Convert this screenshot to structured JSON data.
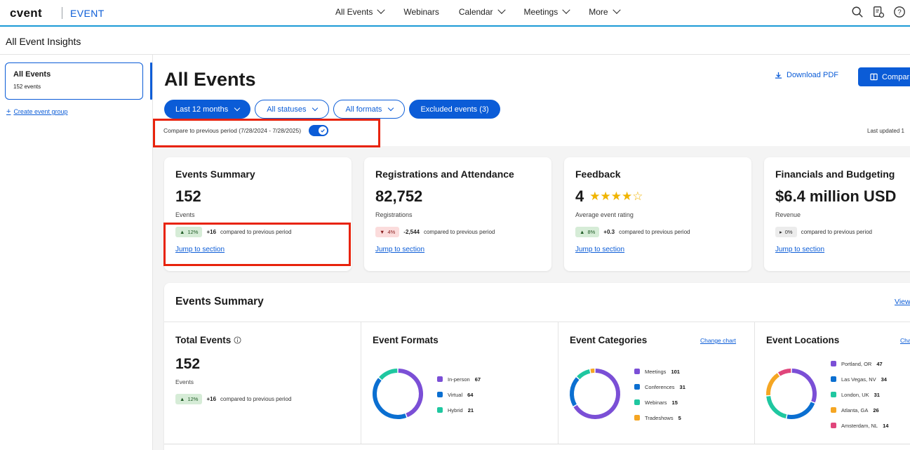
{
  "topnav": {
    "logo": "cvent",
    "product": "EVENT",
    "links": [
      {
        "label": "All Events",
        "dropdown": true
      },
      {
        "label": "Webinars",
        "dropdown": false
      },
      {
        "label": "Calendar",
        "dropdown": true
      },
      {
        "label": "Meetings",
        "dropdown": true
      },
      {
        "label": "More",
        "dropdown": true
      }
    ],
    "icons": [
      "search-icon",
      "reports-icon",
      "help-icon"
    ]
  },
  "breadcrumb": {
    "title": "All Event Insights"
  },
  "sidebar": {
    "group": {
      "name": "All Events",
      "count": "152 events"
    },
    "create_link": "Create event group"
  },
  "main": {
    "title": "All Events",
    "download_pdf": "Download PDF",
    "compare_button": "Compar",
    "filters": [
      {
        "label": "Last 12 months",
        "style": "solid",
        "dropdown": true
      },
      {
        "label": "All statuses",
        "style": "outline",
        "dropdown": true
      },
      {
        "label": "All formats",
        "style": "outline",
        "dropdown": true
      },
      {
        "label": "Excluded events (3)",
        "style": "solid",
        "dropdown": false
      }
    ],
    "compare_toggle": {
      "label": "Compare to previous period (7/28/2024 - 7/28/2025)",
      "on": true
    },
    "last_updated": "Last updated 1"
  },
  "cards": [
    {
      "title": "Events Summary",
      "value": "152",
      "label": "Events",
      "badge": "12%",
      "trend": "up",
      "change": "+16",
      "compare": "compared to previous period",
      "jump": "Jump to section"
    },
    {
      "title": "Registrations and Attendance",
      "value": "82,752",
      "label": "Registrations",
      "badge": "4%",
      "trend": "down",
      "change": "-2,544",
      "compare": "compared to previous period",
      "jump": "Jump to section"
    },
    {
      "title": "Feedback",
      "value": "4",
      "rating": 4,
      "label": "Average event rating",
      "badge": "8%",
      "trend": "up",
      "change": "+0.3",
      "compare": "compared to previous period",
      "jump": "Jump to section"
    },
    {
      "title": "Financials and Budgeting",
      "value": "$6.4 million USD",
      "label": "Revenue",
      "badge": "0%",
      "trend": "flat",
      "change": "",
      "compare": "compared to previous period",
      "jump": "Jump to section"
    }
  ],
  "section": {
    "title": "Events Summary",
    "view_link": "View",
    "total": {
      "title": "Total Events",
      "value": "152",
      "label": "Events",
      "badge": "12%",
      "change": "+16",
      "compare": "compared to previous period"
    },
    "formats": {
      "title": "Event Formats",
      "items": [
        {
          "label": "In-person",
          "value": 67,
          "color": "#7b4fd6"
        },
        {
          "label": "Virtual",
          "value": 64,
          "color": "#0b6fd1"
        },
        {
          "label": "Hybrid",
          "value": 21,
          "color": "#1fc7a0"
        }
      ]
    },
    "categories": {
      "title": "Event Categories",
      "change": "Change chart",
      "items": [
        {
          "label": "Meetings",
          "value": 101,
          "color": "#7b4fd6"
        },
        {
          "label": "Conferences",
          "value": 31,
          "color": "#0b6fd1"
        },
        {
          "label": "Webinars",
          "value": 15,
          "color": "#1fc7a0"
        },
        {
          "label": "Tradeshows",
          "value": 5,
          "color": "#f5a623"
        }
      ]
    },
    "locations": {
      "title": "Event Locations",
      "change": "Chang",
      "items": [
        {
          "label": "Portland, OR",
          "value": 47,
          "color": "#7b4fd6"
        },
        {
          "label": "Las Vegas, NV",
          "value": 34,
          "color": "#0b6fd1"
        },
        {
          "label": "London, UK",
          "value": 31,
          "color": "#1fc7a0"
        },
        {
          "label": "Atlanta, GA",
          "value": 26,
          "color": "#f5a623"
        },
        {
          "label": "Amsterdam, NL",
          "value": 14,
          "color": "#e0457b"
        }
      ]
    }
  }
}
